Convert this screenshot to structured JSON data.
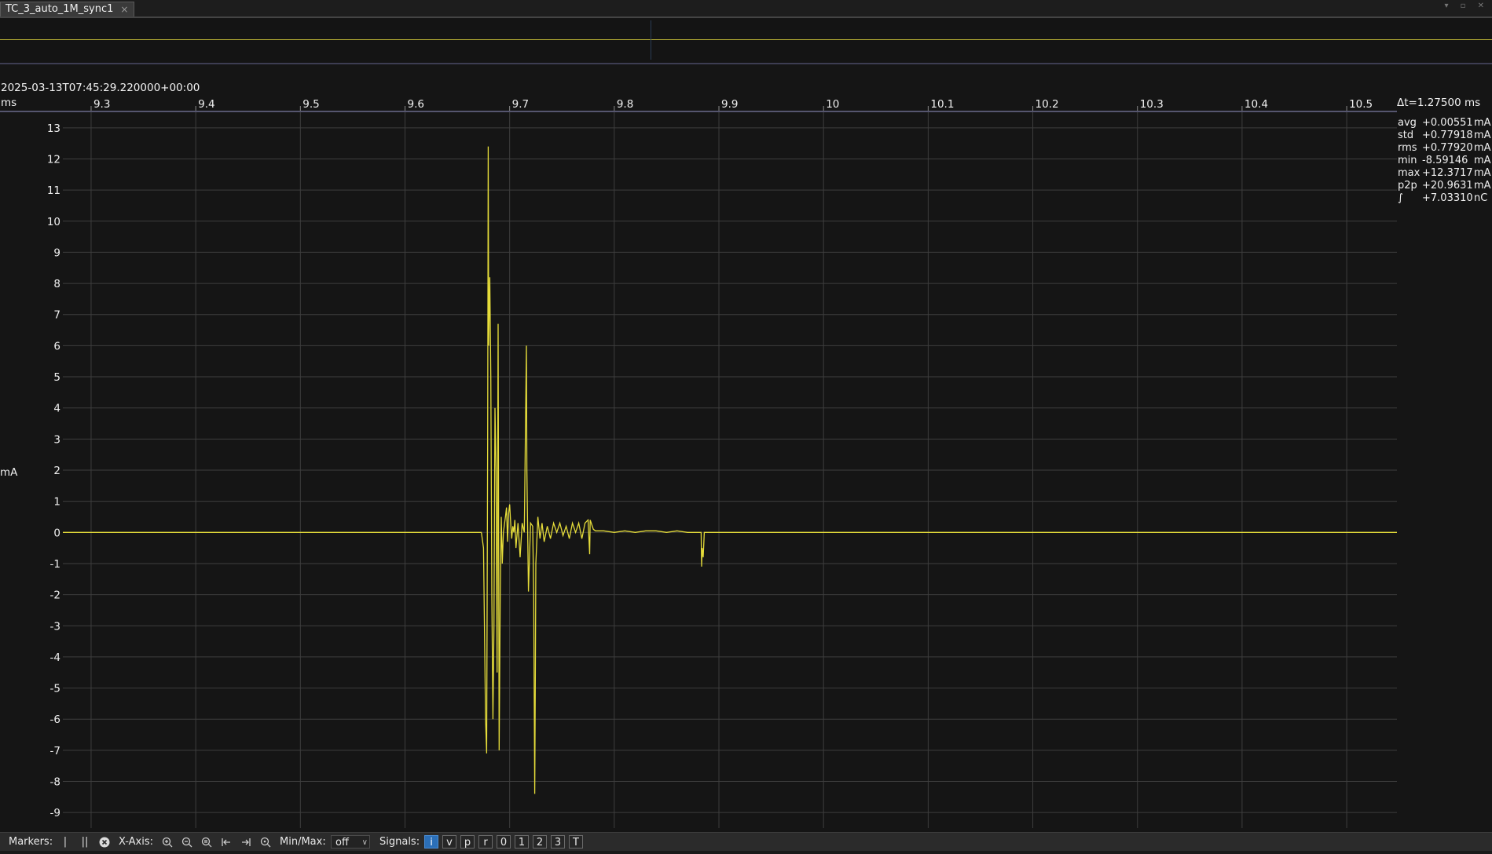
{
  "tab": {
    "title": "TC_3_auto_1M_sync1",
    "close": "×"
  },
  "window_controls": "▾ ▫ ✕",
  "header": {
    "timestamp": "2025-03-13T07:45:29.220000+00:00",
    "x_unit": "ms",
    "delta_t": "Δt=1.27500 ms"
  },
  "y_unit": "mA",
  "stats": [
    {
      "name": "avg",
      "value": "+0.00551",
      "unit": "mA"
    },
    {
      "name": "std",
      "value": "+0.77918",
      "unit": "mA"
    },
    {
      "name": "rms",
      "value": "+0.77920",
      "unit": "mA"
    },
    {
      "name": "min",
      "value": "-8.59146",
      "unit": "mA"
    },
    {
      "name": "max",
      "value": "+12.3717",
      "unit": "mA"
    },
    {
      "name": "p2p",
      "value": "+20.9631",
      "unit": "mA"
    },
    {
      "name": "∫",
      "value": "+7.03310",
      "unit": "nC"
    }
  ],
  "toolbar": {
    "markers_label": "Markers:",
    "xaxis_label": "X-Axis:",
    "minmax_label": "Min/Max:",
    "minmax_value": "off",
    "signals_label": "Signals:",
    "signals": [
      "i",
      "v",
      "p",
      "r",
      "0",
      "1",
      "2",
      "3",
      "T"
    ]
  },
  "colors": {
    "trace": "#e5dc3a",
    "background": "#151515",
    "grid": "#3e3e3e",
    "active_signal": "#2b6fb8"
  },
  "chart_data": {
    "type": "line",
    "xlabel": "ms",
    "ylabel": "mA",
    "x_ticks": [
      "9.3",
      "9.4",
      "9.5",
      "9.6",
      "9.7",
      "9.8",
      "9.9",
      "10",
      "10.1",
      "10.2",
      "10.3",
      "10.4",
      "10.5"
    ],
    "y_ticks": [
      "13",
      "12",
      "11",
      "10",
      "9",
      "8",
      "7",
      "6",
      "5",
      "4",
      "3",
      "2",
      "1",
      "0",
      "-1",
      "-2",
      "-3",
      "-4",
      "-5",
      "-6",
      "-7",
      "-8",
      "-9"
    ],
    "xlim": [
      9.273,
      10.548
    ],
    "ylim": [
      -9.5,
      13.5
    ],
    "grid": true,
    "series": [
      {
        "x": [
          9.273,
          9.673,
          9.675,
          9.677,
          9.678,
          9.679,
          9.6795,
          9.68,
          9.681,
          9.682,
          9.683,
          9.684,
          9.685,
          9.686,
          9.687,
          9.688,
          9.689,
          9.69,
          9.691,
          9.692,
          9.693,
          9.694,
          9.696,
          9.697,
          9.698,
          9.699,
          9.7,
          9.701,
          9.702,
          9.703,
          9.704,
          9.705,
          9.706,
          9.708,
          9.71,
          9.712,
          9.714,
          9.716,
          9.7165,
          9.718,
          9.72,
          9.722,
          9.723,
          9.724,
          9.7245,
          9.725,
          9.727,
          9.729,
          9.731,
          9.733,
          9.736,
          9.739,
          9.742,
          9.745,
          9.748,
          9.751,
          9.754,
          9.757,
          9.76,
          9.763,
          9.766,
          9.769,
          9.772,
          9.775,
          9.7765,
          9.777,
          9.78,
          9.782,
          9.79,
          9.8,
          9.81,
          9.82,
          9.83,
          9.84,
          9.85,
          9.86,
          9.87,
          9.883,
          9.8835,
          9.884,
          9.885,
          9.886,
          9.888,
          9.9,
          9.94,
          10.548
        ],
        "y": [
          0,
          0,
          -0.5,
          -6.0,
          -7.1,
          3.0,
          12.4,
          6.0,
          8.2,
          5.0,
          -2.0,
          -6.0,
          -3.0,
          4.0,
          2.0,
          -4.5,
          6.7,
          -7.0,
          -2.0,
          0.5,
          -1.0,
          0.0,
          0.5,
          0.8,
          -0.3,
          0.6,
          0.9,
          0.3,
          -0.2,
          0.2,
          0.0,
          0.4,
          -0.5,
          0.3,
          -0.8,
          0.3,
          0.0,
          6.0,
          2.0,
          -1.9,
          0.3,
          0.2,
          -2.0,
          -8.4,
          -5.0,
          -1.0,
          0.5,
          -0.2,
          0.3,
          -0.3,
          0.2,
          -0.2,
          0.3,
          0.0,
          0.3,
          -0.1,
          0.2,
          -0.2,
          0.3,
          0.0,
          0.3,
          -0.2,
          0.3,
          0.4,
          -0.7,
          0.4,
          0.1,
          0.05,
          0.05,
          0.0,
          0.05,
          0.0,
          0.05,
          0.05,
          0.0,
          0.05,
          0.0,
          0.0,
          -1.1,
          -0.5,
          -0.8,
          0.0,
          0.0,
          0.0,
          0.0,
          0.0
        ]
      }
    ]
  }
}
